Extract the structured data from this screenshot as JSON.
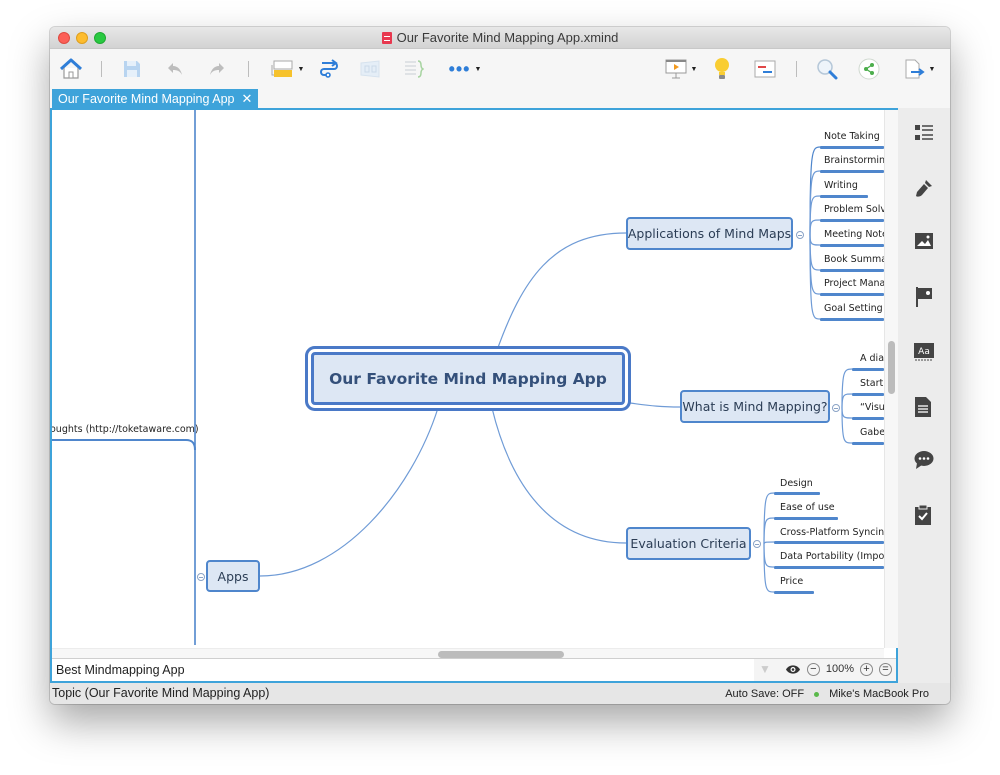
{
  "window": {
    "title": "Our Favorite Mind Mapping App.xmind"
  },
  "toolbar": {
    "items": [
      {
        "name": "home",
        "icon": "home-icon"
      },
      {
        "name": "save",
        "icon": "save-icon"
      },
      {
        "name": "undo",
        "icon": "undo-icon"
      },
      {
        "name": "redo",
        "icon": "redo-icon"
      },
      {
        "name": "insert-topic",
        "icon": "topic-icon"
      },
      {
        "name": "relationship",
        "icon": "relationship-icon"
      },
      {
        "name": "boundary",
        "icon": "boundary-icon"
      },
      {
        "name": "summary",
        "icon": "summary-icon"
      },
      {
        "name": "more",
        "icon": "more-icon"
      },
      {
        "name": "presentation",
        "icon": "presentation-icon"
      },
      {
        "name": "brainstorm",
        "icon": "lightbulb-icon"
      },
      {
        "name": "gantt",
        "icon": "gantt-icon"
      },
      {
        "name": "search",
        "icon": "search-icon"
      },
      {
        "name": "share",
        "icon": "share-icon"
      },
      {
        "name": "export",
        "icon": "export-icon"
      }
    ]
  },
  "tab": {
    "label": "Our Favorite Mind Mapping App",
    "close": "✕"
  },
  "mindmap": {
    "central": "Our Favorite Mind Mapping App",
    "branches": [
      {
        "label": "Applications of Mind Maps",
        "children": [
          "Note Taking",
          "Brainstorming",
          "Writing",
          "Problem Solvi",
          "Meeting Notes",
          "Book Summar",
          "Project Manag",
          "Goal Setting"
        ]
      },
      {
        "label": "What is Mind Mapping?",
        "children": [
          "A diag",
          "Start",
          "“Visua",
          "Gabe"
        ]
      },
      {
        "label": "Evaluation Criteria",
        "children": [
          "Design",
          "Ease of use",
          "Cross-Platform Syncing",
          "Data Portability (Import/I",
          "Price"
        ]
      },
      {
        "label": "Apps",
        "children": [
          "oughts (http://toketaware.com)"
        ]
      }
    ]
  },
  "sheetbar": {
    "sheet_label": "Best Mindmapping App",
    "zoom_level": "100%"
  },
  "sidebar": {
    "items": [
      {
        "name": "outline",
        "icon": "outline-icon"
      },
      {
        "name": "format",
        "icon": "brush-icon"
      },
      {
        "name": "image",
        "icon": "image-icon"
      },
      {
        "name": "markers",
        "icon": "flag-icon"
      },
      {
        "name": "text-style",
        "icon": "font-icon"
      },
      {
        "name": "notes",
        "icon": "document-icon"
      },
      {
        "name": "comments",
        "icon": "comment-icon"
      },
      {
        "name": "task",
        "icon": "clipboard-check-icon"
      }
    ]
  },
  "status": {
    "selection": "Topic (Our Favorite Mind Mapping App)",
    "autosave": "Auto Save: OFF",
    "device": "Mike's MacBook Pro"
  }
}
